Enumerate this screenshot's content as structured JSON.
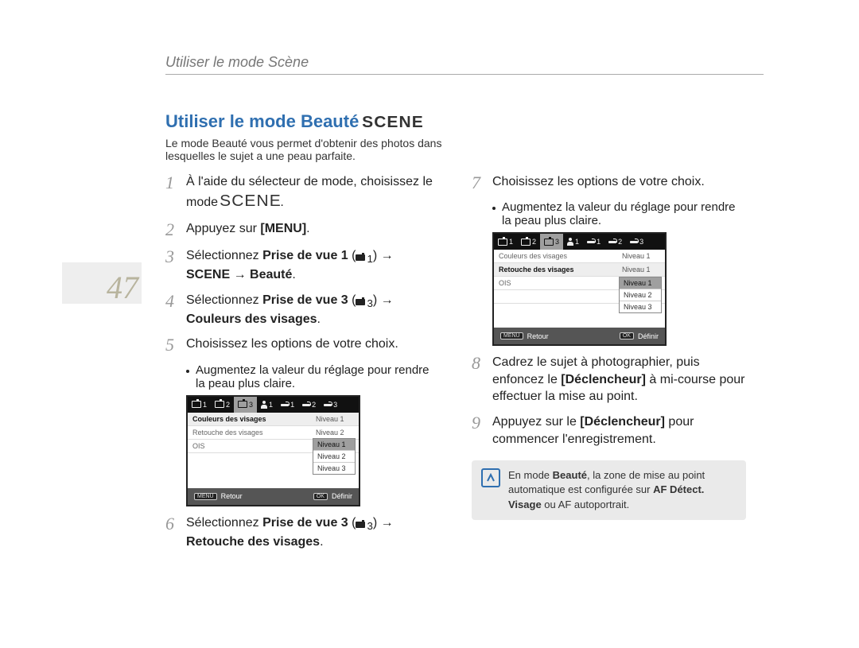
{
  "header": {
    "title": "Utiliser le mode Scène"
  },
  "page_number": "47",
  "section": {
    "title": "Utiliser le mode Beauté",
    "title_badge": "SCENE",
    "description": "Le mode Beauté vous permet d'obtenir des photos dans lesquelles le sujet a une peau parfaite."
  },
  "steps": {
    "s1": {
      "num": "1",
      "text_a": "À l'aide du sélecteur de mode, choisissez le mode ",
      "scene_label": "SCENE",
      "text_b": "."
    },
    "s2": {
      "num": "2",
      "text_a": "Appuyez sur ",
      "menu_label": "[MENU]",
      "text_b": "."
    },
    "s3": {
      "num": "3",
      "text_a": "Sélectionnez ",
      "bold_a": "Prise de vue 1",
      "sub_label": "1",
      "arrow": " →",
      "bold_b": "SCENE",
      "arrow2": " → ",
      "bold_c": "Beauté",
      "text_b": "."
    },
    "s4": {
      "num": "4",
      "text_a": "Sélectionnez ",
      "bold_a": "Prise de vue 3",
      "sub_label": "3",
      "arrow": " →",
      "bold_b": "Couleurs des visages",
      "text_b": "."
    },
    "s5": {
      "num": "5",
      "text": "Choisissez les options de votre choix.",
      "bullet": "Augmentez la valeur du réglage pour rendre la peau plus claire."
    },
    "s6": {
      "num": "6",
      "text_a": "Sélectionnez ",
      "bold_a": "Prise de vue 3",
      "sub_label": "3",
      "arrow": " →",
      "bold_b": "Retouche des visages",
      "text_b": "."
    },
    "s7": {
      "num": "7",
      "text": "Choisissez les options de votre choix.",
      "bullet": "Augmentez la valeur du réglage pour rendre la peau plus claire."
    },
    "s8": {
      "num": "8",
      "text_a": "Cadrez le sujet à photographier, puis enfoncez le ",
      "bold_a": "[Déclencheur]",
      "text_b": " à mi-course pour effectuer la mise au point."
    },
    "s9": {
      "num": "9",
      "text_a": "Appuyez sur le ",
      "bold_a": "[Déclencheur]",
      "text_b": " pour commencer l'enregistrement."
    }
  },
  "camera_menu_a": {
    "tabs": [
      "1",
      "2",
      "3",
      "1",
      "1",
      "2",
      "3"
    ],
    "selected_tab_index": 2,
    "rows": [
      {
        "label": "Couleurs des visages",
        "value": "Niveau 1"
      },
      {
        "label": "Retouche des visages",
        "value": "Niveau 2"
      },
      {
        "label": "OIS",
        "value": "Niveau 3"
      }
    ],
    "selected_row": 0,
    "popup": {
      "options": [
        "Niveau 1",
        "Niveau 2",
        "Niveau 3"
      ],
      "selected": 0
    },
    "footer": {
      "menu_btn": "MENU",
      "back": "Retour",
      "ok_btn": "OK",
      "set": "Définir"
    }
  },
  "camera_menu_b": {
    "tabs": [
      "1",
      "2",
      "3",
      "1",
      "1",
      "2",
      "3"
    ],
    "selected_tab_index": 2,
    "rows": [
      {
        "label": "Couleurs des visages",
        "value": "Niveau 1"
      },
      {
        "label": "Retouche des visages",
        "value": "Niveau 1"
      },
      {
        "label": "OIS",
        "value": "Niveau 2"
      }
    ],
    "selected_row": 1,
    "extra_value": "Niveau 3",
    "popup": {
      "options": [
        "Niveau 1",
        "Niveau 2",
        "Niveau 3"
      ],
      "selected": 0
    },
    "footer": {
      "menu_btn": "MENU",
      "back": "Retour",
      "ok_btn": "OK",
      "set": "Définir"
    }
  },
  "note": {
    "text_a": "En mode ",
    "bold_a": "Beauté",
    "text_b": ", la zone de mise au point automatique est configurée sur ",
    "bold_b": "AF Détect. Visage",
    "text_c": " ou AF autoportrait."
  }
}
